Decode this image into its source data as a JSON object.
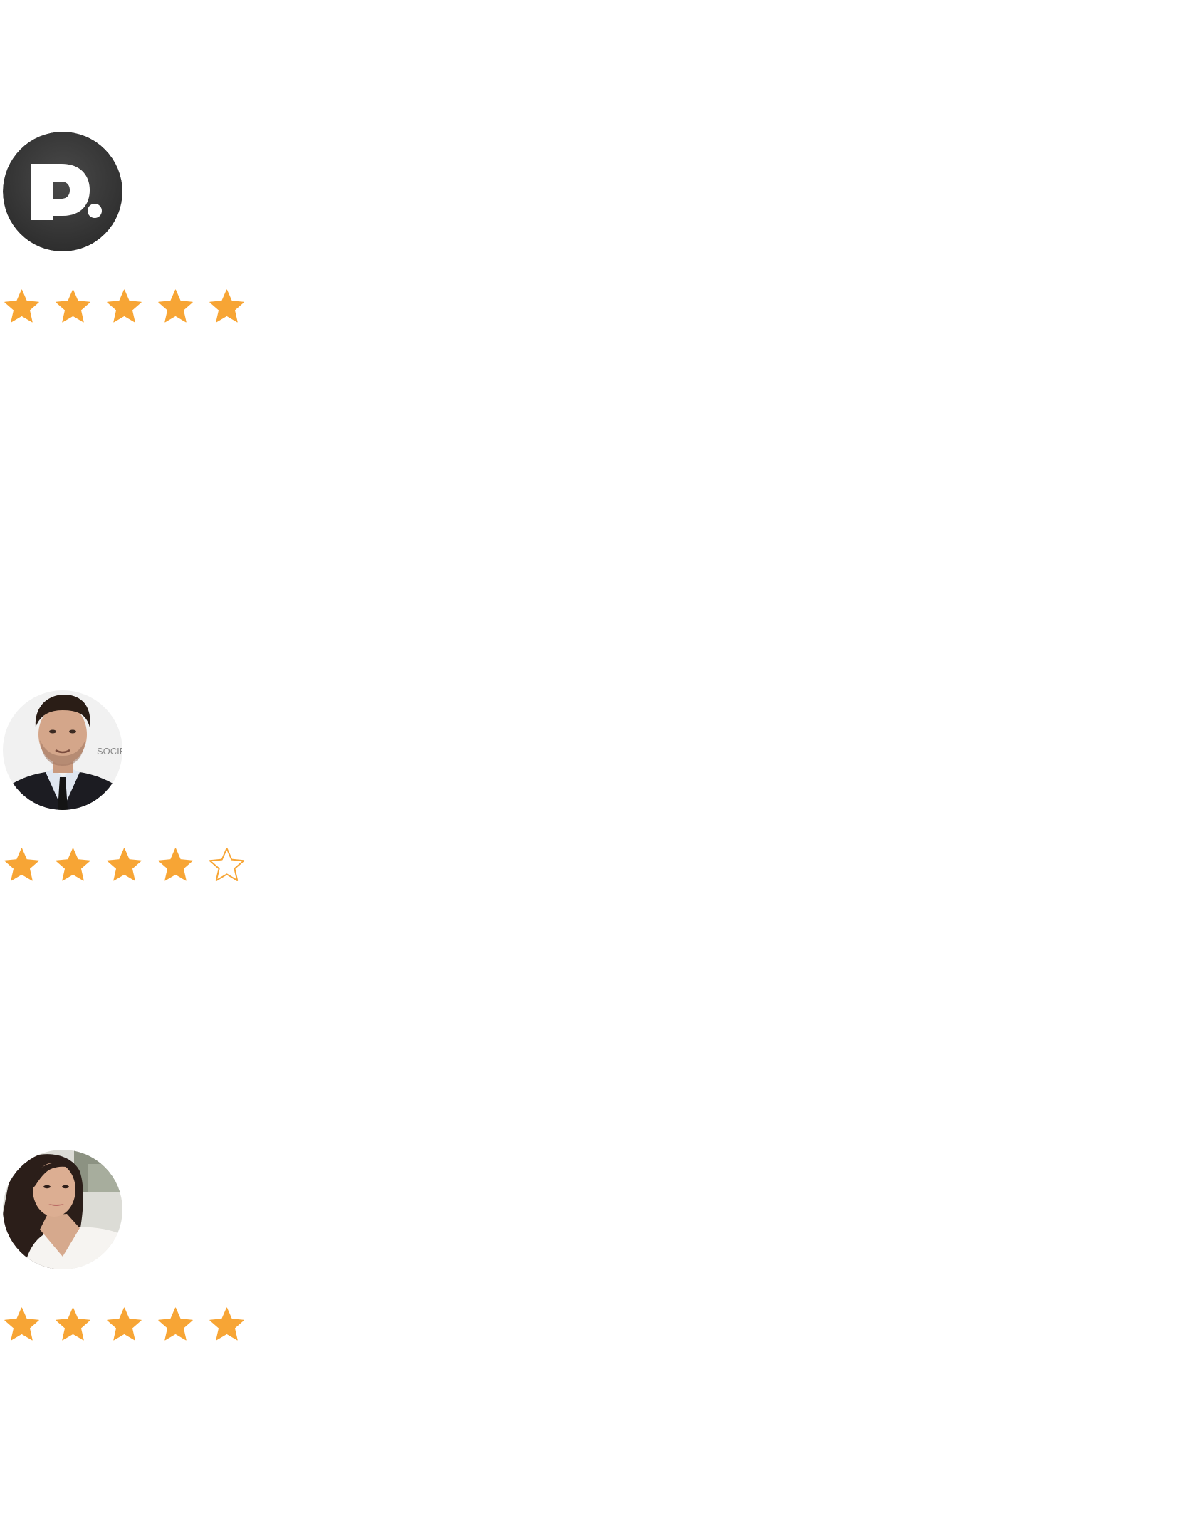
{
  "reviews": [
    {
      "avatar": {
        "kind": "logo",
        "icon": "brand-logo-icon",
        "letter": "D",
        "background": "#3a3a3a",
        "foreground": "#ffffff"
      },
      "rating": 5,
      "max_rating": 5
    },
    {
      "avatar": {
        "kind": "photo",
        "icon": "man-portrait-photo",
        "background": "#f1f1f1"
      },
      "rating": 4,
      "max_rating": 5
    },
    {
      "avatar": {
        "kind": "photo",
        "icon": "woman-portrait-photo",
        "background": "#dcdcd6"
      },
      "rating": 5,
      "max_rating": 5
    }
  ],
  "colors": {
    "star": "#f7a535",
    "page_background": "#ffffff"
  }
}
